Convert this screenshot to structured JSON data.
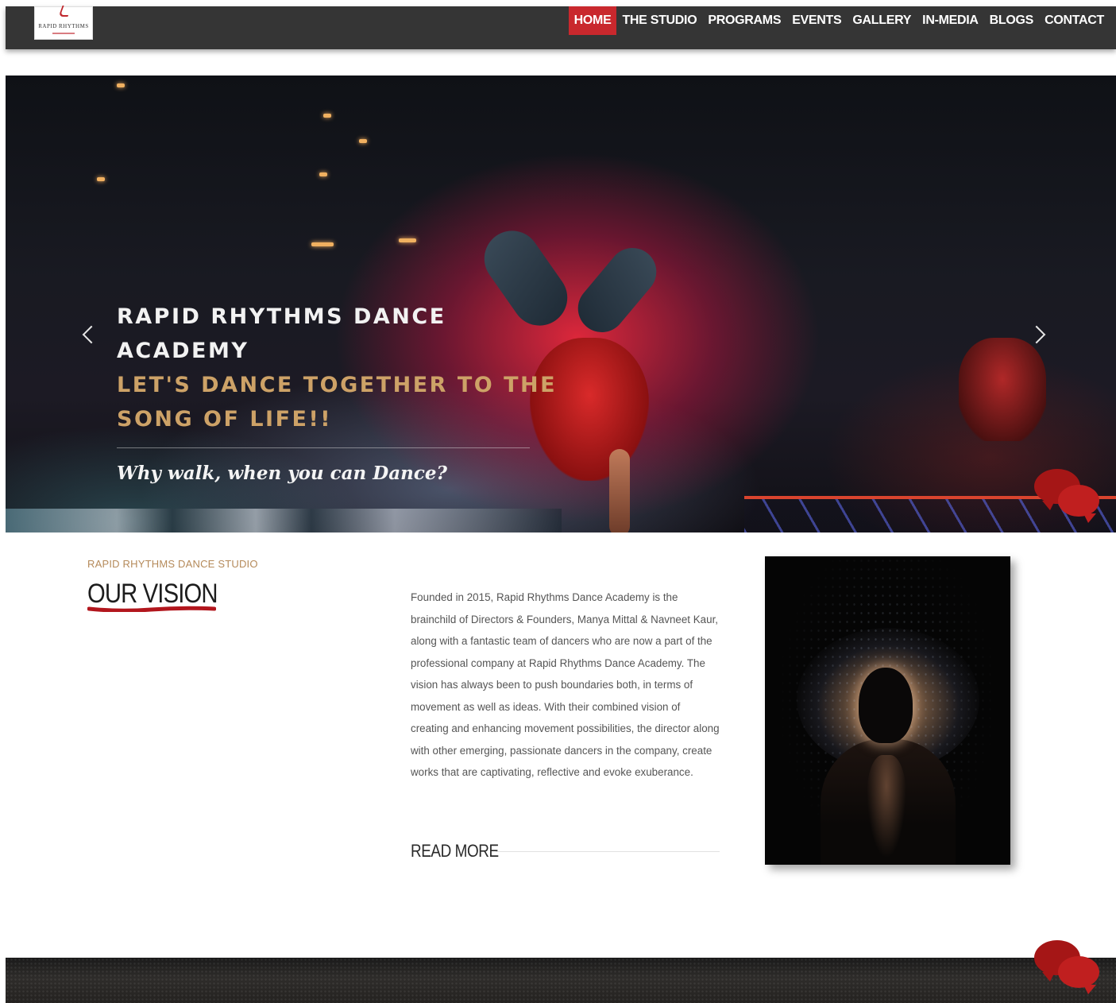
{
  "logo": {
    "text": "RAPID RHYTHMS",
    "icon": "rapid-rhythms-logo"
  },
  "nav": {
    "items": [
      {
        "label": "HOME",
        "active": true
      },
      {
        "label": "THE STUDIO",
        "active": false
      },
      {
        "label": "PROGRAMS",
        "active": false
      },
      {
        "label": "EVENTS",
        "active": false
      },
      {
        "label": "GALLERY",
        "active": false
      },
      {
        "label": "IN-MEDIA",
        "active": false
      },
      {
        "label": "BLOGS",
        "active": false
      },
      {
        "label": "CONTACT",
        "active": false
      }
    ]
  },
  "hero": {
    "title_line1": "RAPID RHYTHMS DANCE",
    "title_line2": "ACADEMY",
    "tagline_line1": "LET'S DANCE TOGETHER TO THE",
    "tagline_line2": "SONG OF LIFE!!",
    "quote": "Why walk, when you can Dance?",
    "prev_icon": "chevron-left-icon",
    "next_icon": "chevron-right-icon"
  },
  "vision": {
    "kicker": "RAPID RHYTHMS DANCE STUDIO",
    "title": "OUR VISION",
    "text": "Founded in 2015, Rapid Rhythms Dance Academy is the brainchild of Directors & Founders, Manya Mittal & Navneet Kaur, along with a fantastic team of dancers who are now a part of the professional company at Rapid Rhythms Dance Academy. The vision has always been to push boundaries both, in terms of movement as well as ideas. With their combined vision of creating and enhancing movement possibilities, the director along with other emerging, passionate dancers in the company, create works that are captivating, reflective and evoke exuberance.",
    "read_more": "READ MORE"
  },
  "chat_icon": "chat-bubbles-icon",
  "colors": {
    "nav_bg": "#353535",
    "active": "#c9282d",
    "tagline_gold": "#cda267",
    "kicker": "#b58a5a",
    "chat_red": "#a51616"
  }
}
